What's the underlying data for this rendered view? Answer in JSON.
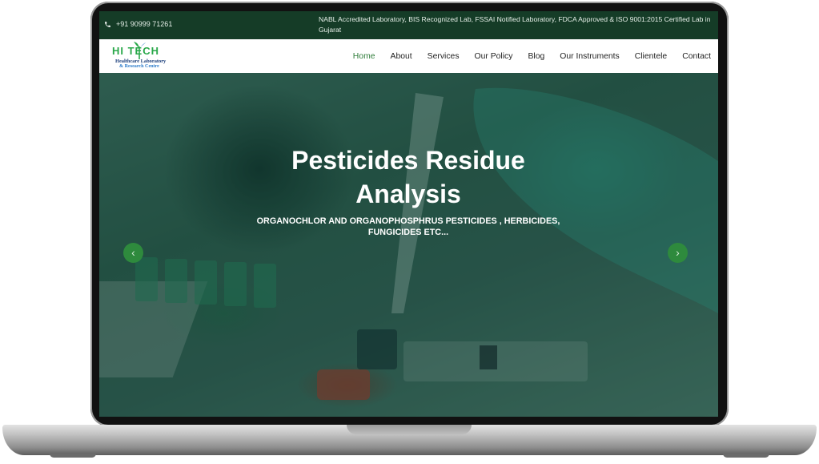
{
  "topbar": {
    "phone": "+91 90999 71261",
    "certifications": "NABL Accredited Laboratory, BIS Recognized Lab, FSSAI Notified Laboratory, FDCA Approved & ISO 9001:2015 Certified Lab in Gujarat"
  },
  "logo": {
    "line1": "HI TECH",
    "line2": "Healthcare Laboratory",
    "line3": "& Research Centre"
  },
  "nav": {
    "items": [
      {
        "label": "Home",
        "active": true
      },
      {
        "label": "About"
      },
      {
        "label": "Services"
      },
      {
        "label": "Our Policy"
      },
      {
        "label": "Blog"
      },
      {
        "label": "Our Instruments"
      },
      {
        "label": "Clientele"
      },
      {
        "label": "Contact"
      }
    ]
  },
  "hero": {
    "title": "Pesticides Residue Analysis",
    "subtitle": "ORGANOCHLOR AND ORGANOPHOSPHRUS PESTICIDES , HERBICIDES, FUNGICIDES ETC...",
    "prev_icon": "chevron-left-icon",
    "next_icon": "chevron-right-icon"
  },
  "colors": {
    "topbar_bg": "#153c27",
    "accent_green": "#2f7d3a",
    "arrow_bg": "#2e8a3d"
  }
}
